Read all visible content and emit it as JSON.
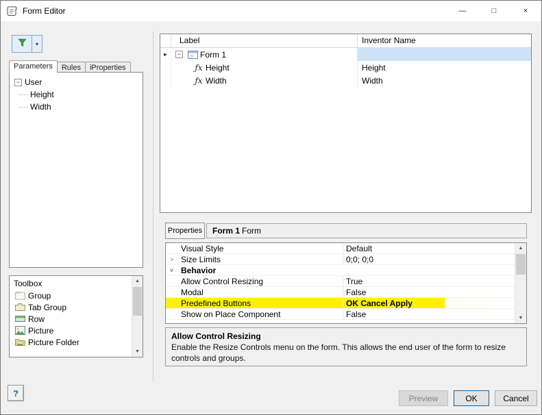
{
  "window": {
    "title": "Form Editor"
  },
  "colors": {
    "highlight_yellow": "#fff101",
    "selection_blue": "#cde3f7",
    "default_button_border": "#0b63ad",
    "funnel_green": "#37a03c"
  },
  "icons": {
    "minimize": "—",
    "maximize": "□",
    "close": "×",
    "dropdown": "▾",
    "collapse": "−",
    "chevron": ">",
    "record_arrow": "►",
    "fx": "ƒx",
    "scroll_up": "▲",
    "scroll_down": "▼",
    "help": "?"
  },
  "left_panel": {
    "tabs": [
      {
        "label": "Parameters",
        "active": true
      },
      {
        "label": "Rules",
        "active": false
      },
      {
        "label": "iProperties",
        "active": false
      }
    ],
    "parameter_tree": {
      "root": "User",
      "children": [
        {
          "label": "Height"
        },
        {
          "label": "Width"
        }
      ]
    },
    "toolbox": {
      "title": "Toolbox",
      "items": [
        {
          "label": "Group",
          "icon": "group-icon"
        },
        {
          "label": "Tab Group",
          "icon": "tab-group-icon"
        },
        {
          "label": "Row",
          "icon": "row-icon"
        },
        {
          "label": "Picture",
          "icon": "picture-icon"
        },
        {
          "label": "Picture Folder",
          "icon": "picture-folder-icon"
        }
      ]
    }
  },
  "form_tree": {
    "columns": {
      "label": "Label",
      "inventor_name": "Inventor Name"
    },
    "rows": [
      {
        "label": "Form 1",
        "inventor_name": "",
        "level": 0,
        "selected": true
      },
      {
        "label": "Height",
        "inventor_name": "Height",
        "level": 1
      },
      {
        "label": "Width",
        "inventor_name": "Width",
        "level": 1
      }
    ]
  },
  "properties_panel": {
    "tab": "Properties",
    "selection_bold": "Form 1",
    "selection_suffix": "Form",
    "rows": [
      {
        "name": "Visual Style",
        "value": "Default"
      },
      {
        "name": "Size Limits",
        "value": "0;0; 0;0",
        "expandable": true
      },
      {
        "name": "Behavior",
        "value": "",
        "category": true,
        "expanded": true
      },
      {
        "name": "Allow Control Resizing",
        "value": "True"
      },
      {
        "name": "Modal",
        "value": "False"
      },
      {
        "name": "Predefined Buttons",
        "value": "OK Cancel Apply",
        "highlighted": true
      },
      {
        "name": "Show on Place Component",
        "value": "False"
      }
    ],
    "description": {
      "title": "Allow Control Resizing",
      "text": "Enable the Resize Controls menu on the form.  This allows the end user of the form to resize controls and groups."
    }
  },
  "footer": {
    "preview": "Preview",
    "ok": "OK",
    "cancel": "Cancel"
  }
}
